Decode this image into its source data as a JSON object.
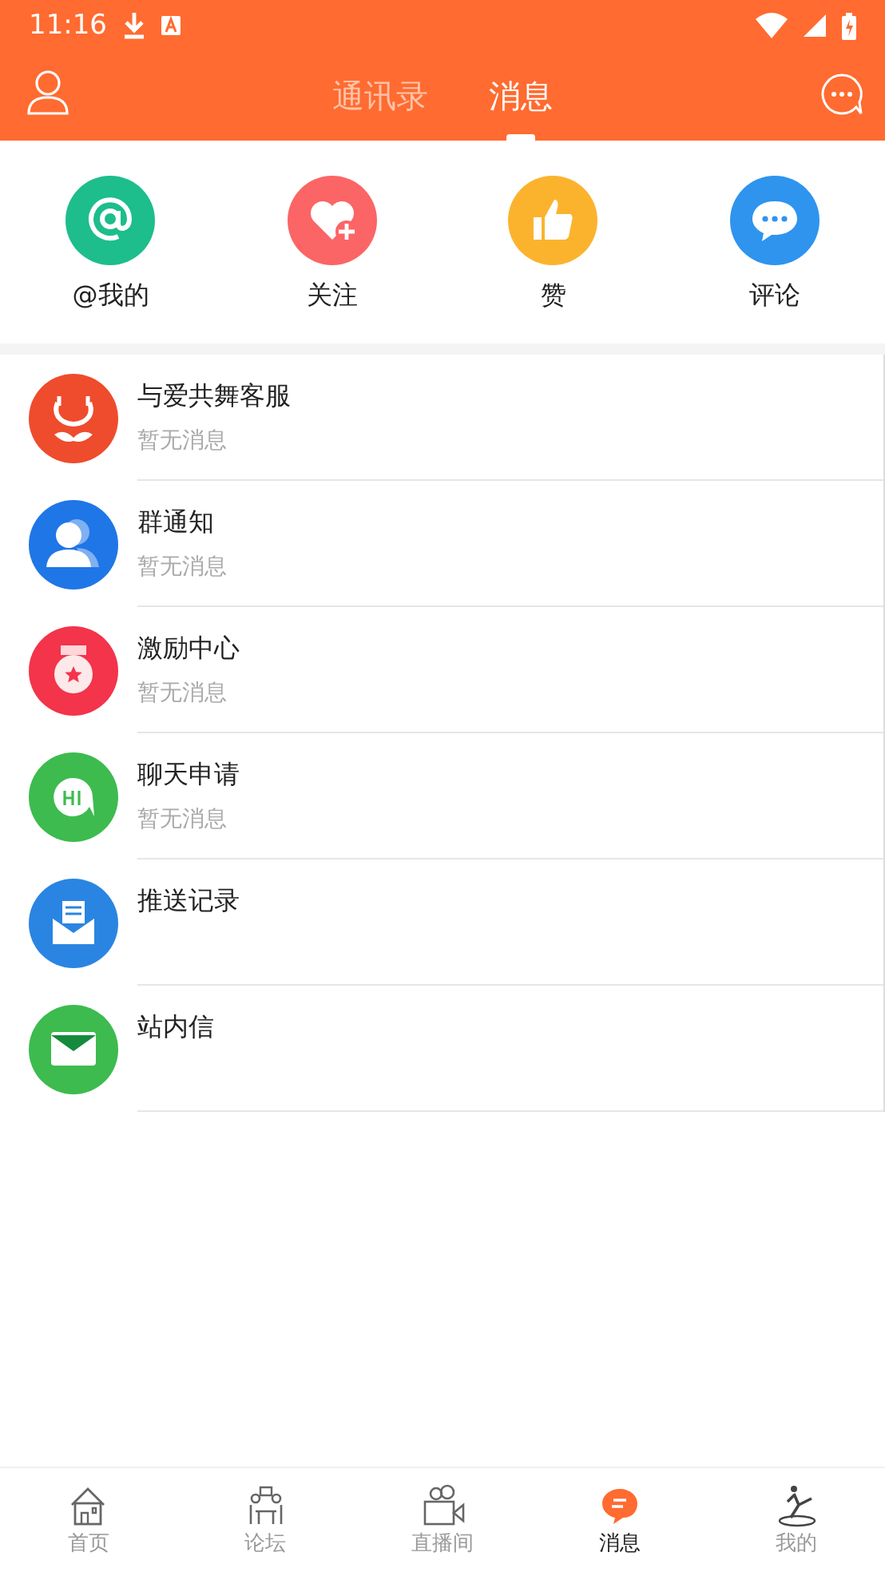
{
  "status_bar": {
    "time": "11:16"
  },
  "header": {
    "tabs": [
      {
        "label": "通讯录",
        "selected": false
      },
      {
        "label": "消息",
        "selected": true
      }
    ]
  },
  "quick_actions": [
    {
      "label": "@我的",
      "kind": "at",
      "color": "#1dbd8c"
    },
    {
      "label": "关注",
      "kind": "follow",
      "color": "#fb6566"
    },
    {
      "label": "赞",
      "kind": "like",
      "color": "#fbb32e"
    },
    {
      "label": "评论",
      "kind": "comment",
      "color": "#2e94ee"
    }
  ],
  "messages": [
    {
      "title": "与爱共舞客服",
      "subtitle": "暂无消息",
      "kind": "service",
      "color": "#ee4c2c"
    },
    {
      "title": "群通知",
      "subtitle": "暂无消息",
      "kind": "group",
      "color": "#1f76e6"
    },
    {
      "title": "激励中心",
      "subtitle": "暂无消息",
      "kind": "reward",
      "color": "#f3344a"
    },
    {
      "title": "聊天申请",
      "subtitle": "暂无消息",
      "kind": "chat",
      "color": "#3dbb4e"
    },
    {
      "title": "推送记录",
      "kind": "push",
      "color": "#2a85e2"
    },
    {
      "title": "站内信",
      "kind": "mail",
      "color": "#3dbb4e"
    }
  ],
  "bottom_nav": [
    {
      "label": "首页",
      "kind": "home",
      "selected": false
    },
    {
      "label": "论坛",
      "kind": "forum",
      "selected": false
    },
    {
      "label": "直播间",
      "kind": "live",
      "selected": false
    },
    {
      "label": "消息",
      "kind": "message",
      "selected": true
    },
    {
      "label": "我的",
      "kind": "me",
      "selected": false
    }
  ]
}
